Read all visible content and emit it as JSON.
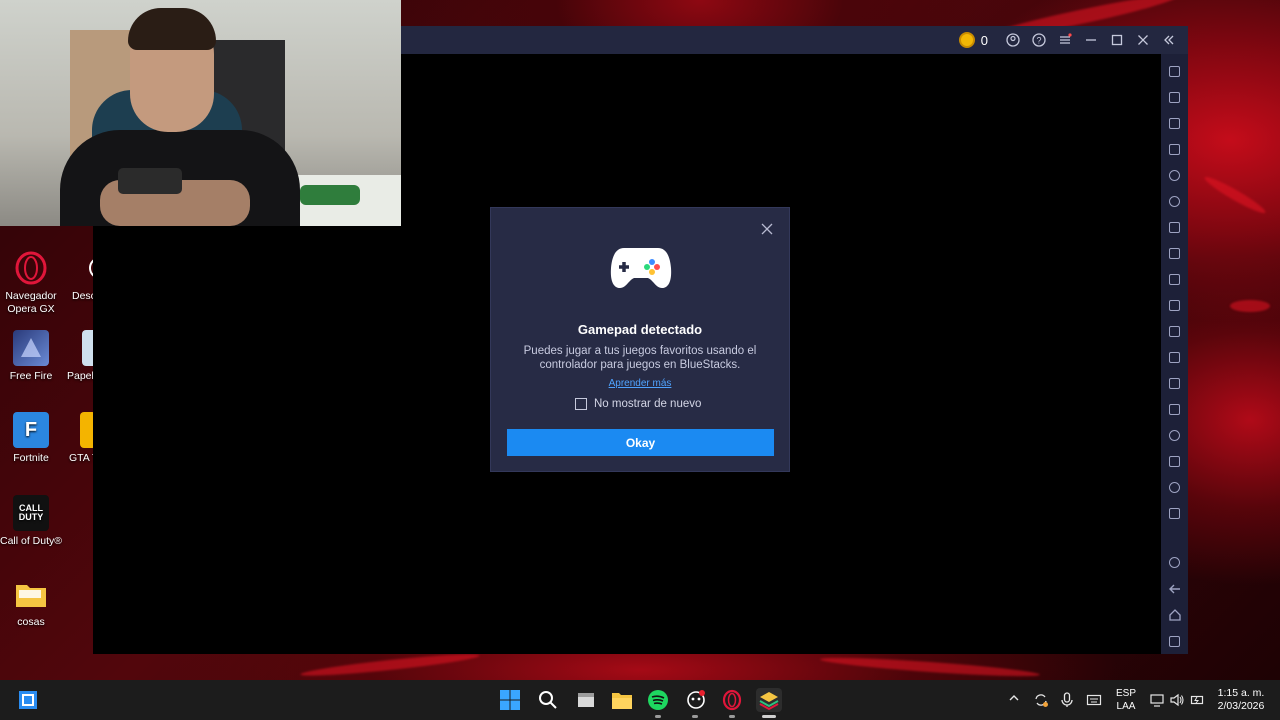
{
  "colors": {
    "dialog_bg": "#272b45",
    "button_bg": "#1b8af2",
    "link": "#4fa3ff",
    "titlebar_bg": "#232740",
    "sidebar_bg": "#1d2038",
    "taskbar_bg": "#1c1c1c"
  },
  "desktop": {
    "icons": [
      {
        "label": "Navegador Opera GX",
        "icon": "opera-gx-icon"
      },
      {
        "label": "Desc más",
        "icon": "download-icon"
      },
      {
        "label": "Free Fire",
        "icon": "free-fire-icon"
      },
      {
        "label": "Papel reci",
        "icon": "recycle-bin-icon"
      },
      {
        "label": "Fortnite",
        "icon": "fortnite-icon"
      },
      {
        "label": "GTA The D",
        "icon": "gta-icon"
      },
      {
        "label": "Call of Duty®",
        "icon": "call-of-duty-icon"
      },
      {
        "label": "cosas",
        "icon": "folder-icon"
      }
    ],
    "fortnite_letter": "F",
    "cod_text": "CALL DUTY"
  },
  "bluestacks": {
    "coins": "0",
    "dialog": {
      "title": "Gamepad detectado",
      "message": "Puedes jugar a tus juegos favoritos usando el controlador para juegos en BlueStacks.",
      "link": "Aprender más",
      "checkbox_label": "No mostrar de nuevo",
      "checkbox_checked": false,
      "button": "Okay"
    }
  },
  "taskbar": {
    "language": "ESP",
    "layout": "LAA",
    "time": "1:15 a. m.",
    "date": "2/03/2026"
  }
}
